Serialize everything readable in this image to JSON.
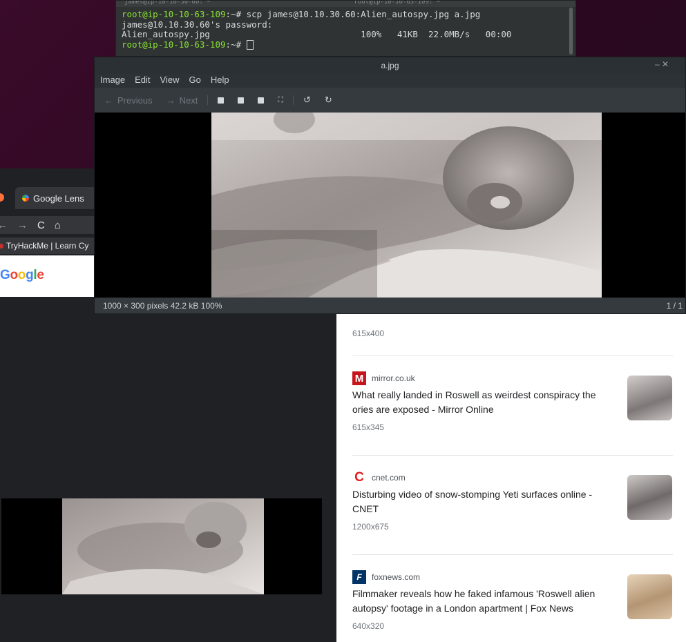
{
  "terminal": {
    "tab1": "james@ip-10-10-30-60: ~",
    "tab2": "root@ip-10-10-63-109: ~",
    "line1_prompt": "root@ip-10-10-63-109",
    "line1_cmd": ":~# scp james@10.10.30.60:Alien_autospy.jpg a.jpg",
    "line2": "james@10.10.30.60's password:",
    "line3": "Alien_autospy.jpg                             100%   41KB  22.0MB/s   00:00",
    "line4_prompt": "root@ip-10-10-63-109",
    "line4_cmd": ":~# "
  },
  "browser": {
    "tab_label": "Google Lens",
    "bookmark": "TryHackMe | Learn Cy",
    "nav": [
      "←",
      "→",
      "C",
      "⌂"
    ],
    "logo_letters": [
      {
        "ch": "G",
        "color": "#4285f4"
      },
      {
        "ch": "o",
        "color": "#ea4335"
      },
      {
        "ch": "o",
        "color": "#fbbc05"
      },
      {
        "ch": "g",
        "color": "#4285f4"
      },
      {
        "ch": "l",
        "color": "#34a853"
      },
      {
        "ch": "e",
        "color": "#ea4335"
      }
    ]
  },
  "results": {
    "first_size": "615x400",
    "items": [
      {
        "source": "mirror.co.uk",
        "fav": "M",
        "fav_color": "#c4161c",
        "title": "What really landed in Roswell as weirdest conspiracy the ories are exposed - Mirror Online",
        "size": "615x345"
      },
      {
        "source": "cnet.com",
        "fav": "C",
        "fav_color": "#e71d1d",
        "title": "Disturbing video of snow-stomping Yeti surfaces online - CNET",
        "size": "1200x675"
      },
      {
        "source": "foxnews.com",
        "fav": "F",
        "fav_color": "#003366",
        "title": "Filmmaker reveals how he faked infamous 'Roswell alien autopsy' footage in a London apartment | Fox News",
        "size": "640x320"
      }
    ]
  },
  "viewer": {
    "title": "a.jpg",
    "menu": [
      "Image",
      "Edit",
      "View",
      "Go",
      "Help"
    ],
    "previous": "Previous",
    "next": "Next",
    "status_left": "1000 × 300 pixels  42.2 kB   100%",
    "status_right": "1 / 1",
    "controls": "–  ✕"
  }
}
